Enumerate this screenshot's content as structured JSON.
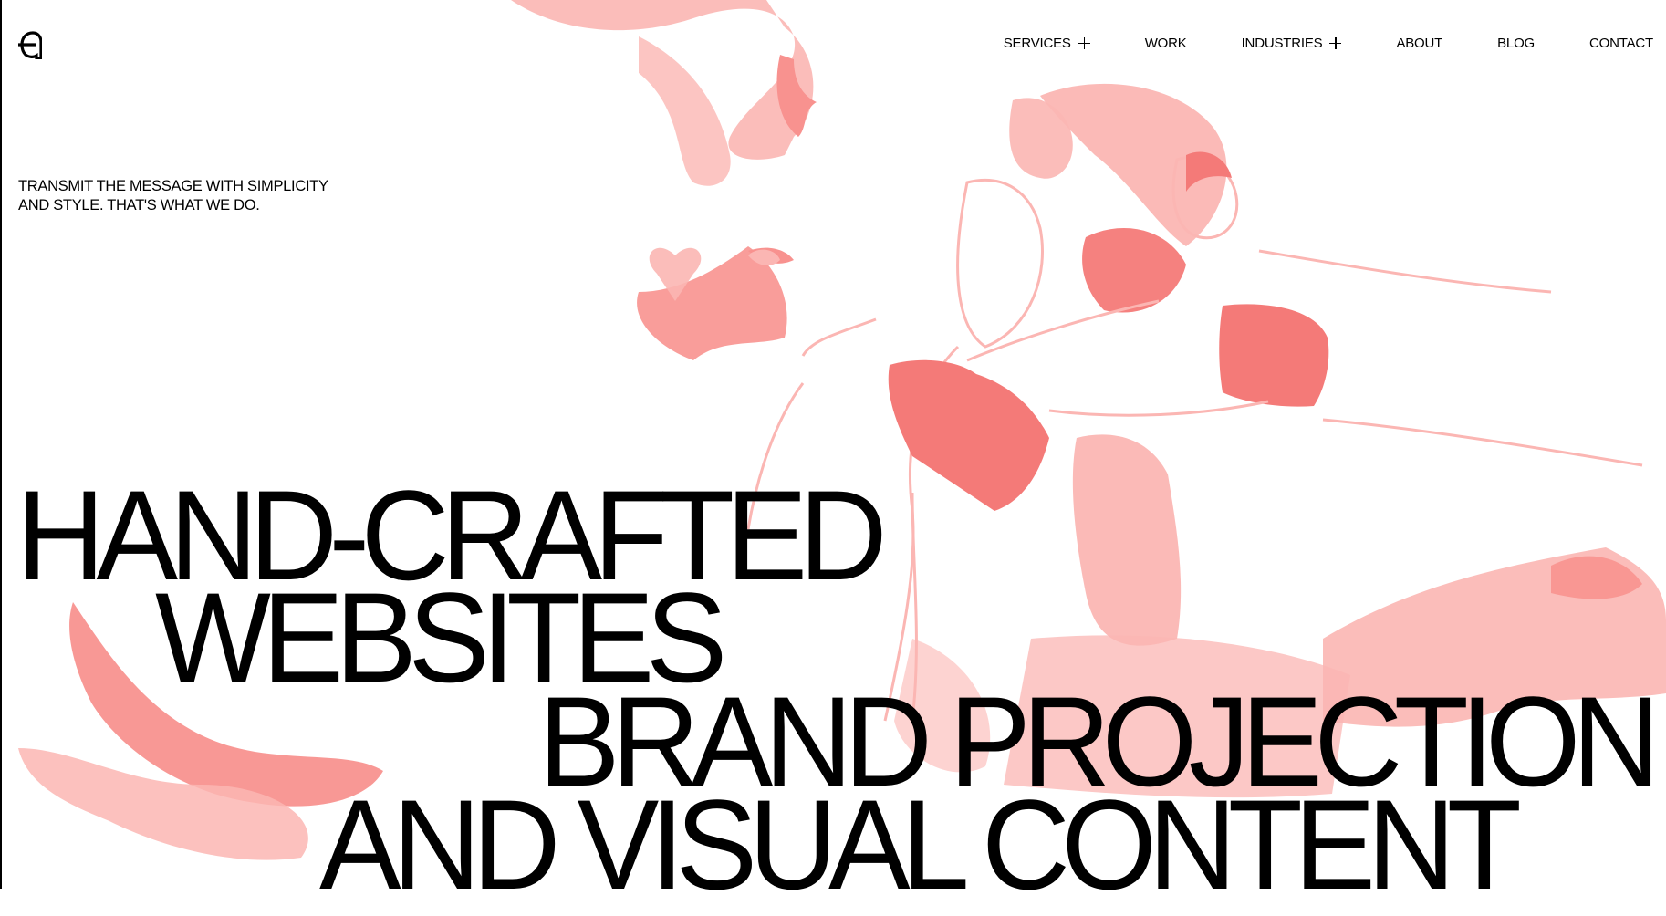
{
  "colors": {
    "background": "#ffffff",
    "text": "#000000",
    "illustration_light": "#fbb6b3",
    "illustration_mid": "#f8928f",
    "illustration_dark": "#f47a78"
  },
  "header": {
    "logo_icon": "agency-logo-icon",
    "nav": [
      {
        "label": "SERVICES",
        "has_submenu": true,
        "icon": "plus-icon"
      },
      {
        "label": "WORK",
        "has_submenu": false
      },
      {
        "label": "INDUSTRIES",
        "has_submenu": true,
        "icon": "plus-icon"
      },
      {
        "label": "ABOUT",
        "has_submenu": false
      },
      {
        "label": "BLOG",
        "has_submenu": false
      },
      {
        "label": "CONTACT",
        "has_submenu": false
      }
    ]
  },
  "hero": {
    "tagline_line1": "TRANSMIT THE MESSAGE WITH SIMPLICITY",
    "tagline_line2": "AND STYLE. THAT'S WHAT WE DO.",
    "headline": [
      "HAND-CRAFTED",
      "WEBSITES",
      "BRAND PROJECTION",
      "AND VISUAL CONTENT"
    ],
    "illustration": "two-dancers-illustration"
  }
}
